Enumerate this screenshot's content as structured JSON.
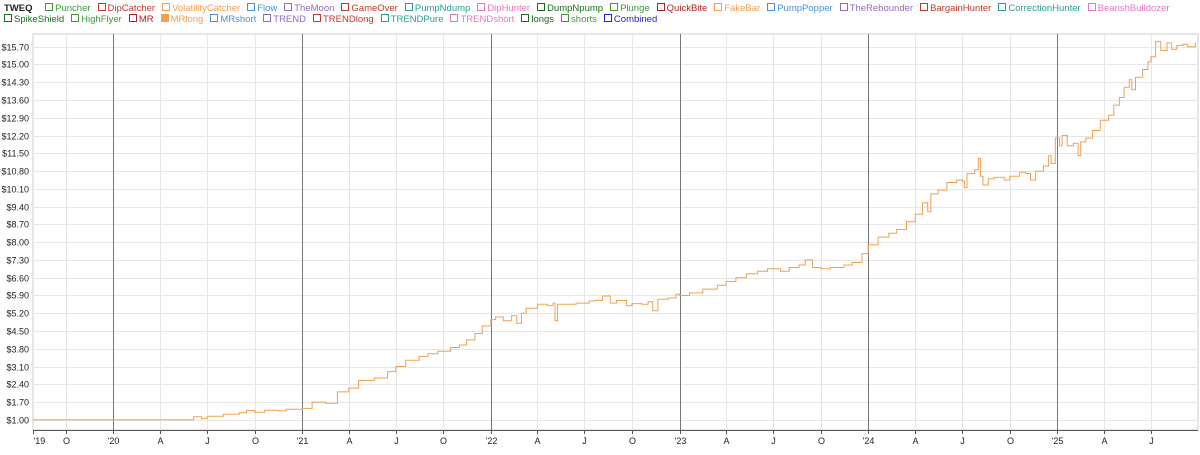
{
  "legend": {
    "title": "TWEQ",
    "items": [
      {
        "label": "Puncher",
        "color": "#3a9a3a",
        "filled": false
      },
      {
        "label": "DipCatcher",
        "color": "#c0392b",
        "filled": false
      },
      {
        "label": "VolatilityCatcher",
        "color": "#f0a050",
        "filled": false
      },
      {
        "label": "Flow",
        "color": "#4a90d9",
        "filled": false
      },
      {
        "label": "TheMoon",
        "color": "#8e6bbf",
        "filled": false
      },
      {
        "label": "GameOver",
        "color": "#c0392b",
        "filled": false
      },
      {
        "label": "PumpNdump",
        "color": "#2a9d8f",
        "filled": false
      },
      {
        "label": "DipHunter",
        "color": "#e377c2",
        "filled": false
      },
      {
        "label": "DumpNpump",
        "color": "#1a6b1a",
        "filled": false
      },
      {
        "label": "Plunge",
        "color": "#3a9a3a",
        "filled": false
      },
      {
        "label": "QuickBite",
        "color": "#b22222",
        "filled": false
      },
      {
        "label": "FakeBar",
        "color": "#f0a050",
        "filled": false
      },
      {
        "label": "PumpPopper",
        "color": "#4a90d9",
        "filled": false
      },
      {
        "label": "TheRebounder",
        "color": "#8e6bbf",
        "filled": false
      },
      {
        "label": "BargainHunter",
        "color": "#c0392b",
        "filled": false
      },
      {
        "label": "CorrectionHunter",
        "color": "#2a9d8f",
        "filled": false
      },
      {
        "label": "BearishBulldozer",
        "color": "#e377c2",
        "filled": false
      },
      {
        "label": "SpikeShield",
        "color": "#1a6b1a",
        "filled": false
      },
      {
        "label": "HighFlyer",
        "color": "#3a9a3a",
        "filled": false
      },
      {
        "label": "MR",
        "color": "#b22222",
        "filled": false
      },
      {
        "label": "MRlong",
        "color": "#f0a050",
        "filled": true
      },
      {
        "label": "MRshort",
        "color": "#4a90d9",
        "filled": false
      },
      {
        "label": "TREND",
        "color": "#8e6bbf",
        "filled": false
      },
      {
        "label": "TRENDlong",
        "color": "#c0392b",
        "filled": false
      },
      {
        "label": "TRENDPure",
        "color": "#2a9d8f",
        "filled": false
      },
      {
        "label": "TRENDshort",
        "color": "#e377c2",
        "filled": false
      },
      {
        "label": "longs",
        "color": "#1a6b1a",
        "filled": false
      },
      {
        "label": "shorts",
        "color": "#3a9a3a",
        "filled": false
      },
      {
        "label": "Combined",
        "color": "#2222cc",
        "filled": false
      }
    ]
  },
  "chart_data": {
    "type": "line",
    "title": "",
    "xlabel": "",
    "ylabel": "",
    "xlim": [
      "2019-07-30",
      "2025-09-30"
    ],
    "ylim": [
      0.6,
      16.2
    ],
    "y_ticks": [
      "$1.00",
      "$1.70",
      "$2.40",
      "$3.10",
      "$3.80",
      "$4.50",
      "$5.20",
      "$5.90",
      "$6.60",
      "$7.30",
      "$8.00",
      "$8.70",
      "$9.40",
      "$10.10",
      "$10.80",
      "$11.50",
      "$12.20",
      "$12.90",
      "$13.60",
      "$14.30",
      "$15.00",
      "$15.70"
    ],
    "y_tick_values": [
      1.0,
      1.7,
      2.4,
      3.1,
      3.8,
      4.5,
      5.2,
      5.9,
      6.6,
      7.3,
      8.0,
      8.7,
      9.4,
      10.1,
      10.8,
      11.5,
      12.2,
      12.9,
      13.6,
      14.3,
      15.0,
      15.7
    ],
    "x_ticks": [
      {
        "date": "2019-07-30",
        "label": "'19",
        "major": false
      },
      {
        "date": "2019-10-01",
        "label": "O",
        "major": false
      },
      {
        "date": "2020-01-01",
        "label": "'20",
        "major": true
      },
      {
        "date": "2020-04-01",
        "label": "A",
        "major": false
      },
      {
        "date": "2020-07-01",
        "label": "J",
        "major": false
      },
      {
        "date": "2020-10-01",
        "label": "O",
        "major": false
      },
      {
        "date": "2021-01-01",
        "label": "'21",
        "major": true
      },
      {
        "date": "2021-04-01",
        "label": "A",
        "major": false
      },
      {
        "date": "2021-07-01",
        "label": "J",
        "major": false
      },
      {
        "date": "2021-10-01",
        "label": "O",
        "major": false
      },
      {
        "date": "2022-01-01",
        "label": "'22",
        "major": true
      },
      {
        "date": "2022-04-01",
        "label": "A",
        "major": false
      },
      {
        "date": "2022-07-01",
        "label": "J",
        "major": false
      },
      {
        "date": "2022-10-01",
        "label": "O",
        "major": false
      },
      {
        "date": "2023-01-01",
        "label": "'23",
        "major": true
      },
      {
        "date": "2023-04-01",
        "label": "A",
        "major": false
      },
      {
        "date": "2023-07-01",
        "label": "J",
        "major": false
      },
      {
        "date": "2023-10-01",
        "label": "O",
        "major": false
      },
      {
        "date": "2024-01-01",
        "label": "'24",
        "major": true
      },
      {
        "date": "2024-04-01",
        "label": "A",
        "major": false
      },
      {
        "date": "2024-07-01",
        "label": "J",
        "major": false
      },
      {
        "date": "2024-10-01",
        "label": "O",
        "major": false
      },
      {
        "date": "2025-01-01",
        "label": "'25",
        "major": true
      },
      {
        "date": "2025-04-01",
        "label": "A",
        "major": false
      },
      {
        "date": "2025-07-01",
        "label": "J",
        "major": false
      }
    ],
    "grid": true,
    "series": [
      {
        "name": "MRlong",
        "color": "#f0a050",
        "points": [
          [
            "2019-07-30",
            1.0
          ],
          [
            "2020-06-01",
            1.0
          ],
          [
            "2020-06-05",
            1.12
          ],
          [
            "2020-06-20",
            1.05
          ],
          [
            "2020-07-01",
            1.14
          ],
          [
            "2020-08-01",
            1.22
          ],
          [
            "2020-09-01",
            1.28
          ],
          [
            "2020-09-15",
            1.37
          ],
          [
            "2020-10-01",
            1.3
          ],
          [
            "2020-10-20",
            1.38
          ],
          [
            "2020-11-15",
            1.36
          ],
          [
            "2020-12-01",
            1.42
          ],
          [
            "2021-01-01",
            1.45
          ],
          [
            "2021-01-20",
            1.7
          ],
          [
            "2021-02-15",
            1.65
          ],
          [
            "2021-03-10",
            2.1
          ],
          [
            "2021-04-01",
            2.25
          ],
          [
            "2021-04-20",
            2.55
          ],
          [
            "2021-05-20",
            2.65
          ],
          [
            "2021-06-15",
            2.9
          ],
          [
            "2021-07-01",
            3.1
          ],
          [
            "2021-07-20",
            3.35
          ],
          [
            "2021-08-15",
            3.5
          ],
          [
            "2021-09-01",
            3.6
          ],
          [
            "2021-09-20",
            3.7
          ],
          [
            "2021-10-15",
            3.85
          ],
          [
            "2021-11-01",
            3.95
          ],
          [
            "2021-11-15",
            4.15
          ],
          [
            "2021-12-01",
            4.4
          ],
          [
            "2021-12-15",
            4.7
          ],
          [
            "2022-01-01",
            4.95
          ],
          [
            "2022-01-10",
            5.05
          ],
          [
            "2022-01-25",
            4.9
          ],
          [
            "2022-02-10",
            5.1
          ],
          [
            "2022-02-20",
            4.8
          ],
          [
            "2022-03-01",
            5.2
          ],
          [
            "2022-03-10",
            5.4
          ],
          [
            "2022-04-01",
            5.55
          ],
          [
            "2022-04-20",
            5.5
          ],
          [
            "2022-05-01",
            5.6
          ],
          [
            "2022-05-05",
            4.9
          ],
          [
            "2022-05-10",
            5.55
          ],
          [
            "2022-06-15",
            5.6
          ],
          [
            "2022-07-10",
            5.68
          ],
          [
            "2022-07-20",
            5.7
          ],
          [
            "2022-08-05",
            5.88
          ],
          [
            "2022-08-20",
            5.6
          ],
          [
            "2022-09-01",
            5.7
          ],
          [
            "2022-09-20",
            5.5
          ],
          [
            "2022-10-01",
            5.58
          ],
          [
            "2022-10-20",
            5.55
          ],
          [
            "2022-11-01",
            5.65
          ],
          [
            "2022-11-10",
            5.3
          ],
          [
            "2022-11-20",
            5.75
          ],
          [
            "2022-12-10",
            5.8
          ],
          [
            "2022-12-25",
            5.95
          ],
          [
            "2023-01-01",
            5.9
          ],
          [
            "2023-01-20",
            6.0
          ],
          [
            "2023-02-15",
            6.15
          ],
          [
            "2023-03-15",
            6.3
          ],
          [
            "2023-04-01",
            6.45
          ],
          [
            "2023-04-20",
            6.6
          ],
          [
            "2023-05-10",
            6.75
          ],
          [
            "2023-06-01",
            6.85
          ],
          [
            "2023-06-20",
            6.95
          ],
          [
            "2023-07-15",
            6.85
          ],
          [
            "2023-08-01",
            7.0
          ],
          [
            "2023-08-20",
            7.1
          ],
          [
            "2023-09-01",
            7.3
          ],
          [
            "2023-09-15",
            7.0
          ],
          [
            "2023-10-01",
            6.95
          ],
          [
            "2023-10-20",
            7.0
          ],
          [
            "2023-11-15",
            7.1
          ],
          [
            "2023-12-01",
            7.2
          ],
          [
            "2023-12-20",
            7.55
          ],
          [
            "2024-01-01",
            7.9
          ],
          [
            "2024-01-20",
            8.2
          ],
          [
            "2024-02-10",
            8.35
          ],
          [
            "2024-02-25",
            8.5
          ],
          [
            "2024-03-15",
            8.8
          ],
          [
            "2024-04-01",
            9.1
          ],
          [
            "2024-04-15",
            9.55
          ],
          [
            "2024-04-25",
            9.2
          ],
          [
            "2024-05-01",
            9.9
          ],
          [
            "2024-05-15",
            10.05
          ],
          [
            "2024-06-01",
            10.35
          ],
          [
            "2024-06-20",
            10.45
          ],
          [
            "2024-07-01",
            10.4
          ],
          [
            "2024-07-05",
            10.15
          ],
          [
            "2024-07-10",
            10.7
          ],
          [
            "2024-07-25",
            10.85
          ],
          [
            "2024-08-01",
            11.3
          ],
          [
            "2024-08-05",
            10.6
          ],
          [
            "2024-08-10",
            10.25
          ],
          [
            "2024-08-20",
            10.5
          ],
          [
            "2024-09-01",
            10.55
          ],
          [
            "2024-09-20",
            10.45
          ],
          [
            "2024-10-01",
            10.6
          ],
          [
            "2024-10-20",
            10.75
          ],
          [
            "2024-11-01",
            10.7
          ],
          [
            "2024-11-10",
            10.45
          ],
          [
            "2024-11-20",
            10.8
          ],
          [
            "2024-12-05",
            11.0
          ],
          [
            "2024-12-15",
            11.4
          ],
          [
            "2024-12-20",
            11.1
          ],
          [
            "2024-12-28",
            12.1
          ],
          [
            "2025-01-05",
            11.8
          ],
          [
            "2025-01-10",
            12.2
          ],
          [
            "2025-01-20",
            11.8
          ],
          [
            "2025-02-01",
            11.9
          ],
          [
            "2025-02-10",
            11.4
          ],
          [
            "2025-02-15",
            11.95
          ],
          [
            "2025-02-25",
            12.1
          ],
          [
            "2025-03-10",
            12.4
          ],
          [
            "2025-03-25",
            12.8
          ],
          [
            "2025-04-10",
            13.0
          ],
          [
            "2025-04-20",
            13.4
          ],
          [
            "2025-05-01",
            13.7
          ],
          [
            "2025-05-10",
            14.1
          ],
          [
            "2025-05-20",
            14.4
          ],
          [
            "2025-05-25",
            14.0
          ],
          [
            "2025-06-01",
            14.5
          ],
          [
            "2025-06-15",
            14.8
          ],
          [
            "2025-06-25",
            15.1
          ],
          [
            "2025-07-01",
            15.3
          ],
          [
            "2025-07-10",
            15.9
          ],
          [
            "2025-07-20",
            15.55
          ],
          [
            "2025-08-01",
            15.85
          ],
          [
            "2025-08-10",
            15.6
          ],
          [
            "2025-08-20",
            15.75
          ],
          [
            "2025-09-01",
            15.8
          ],
          [
            "2025-09-10",
            15.7
          ],
          [
            "2025-09-25",
            15.85
          ]
        ]
      }
    ]
  }
}
